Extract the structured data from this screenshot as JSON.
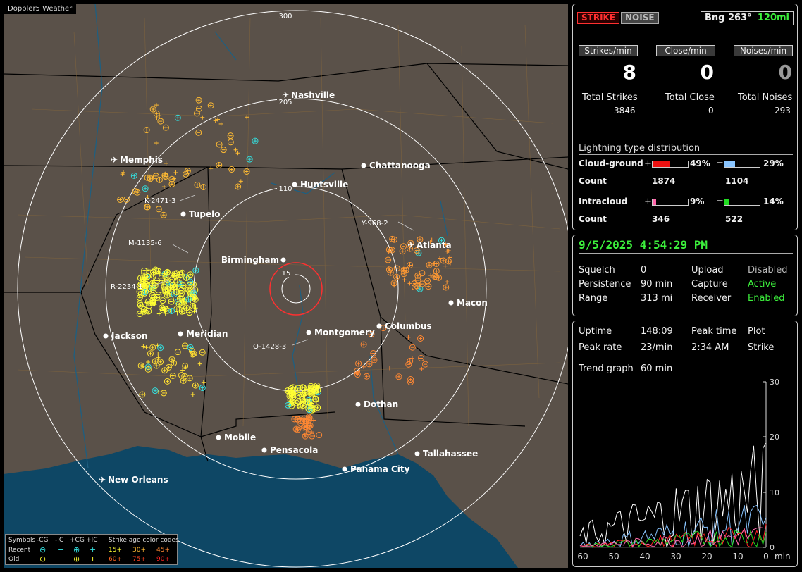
{
  "app": {
    "title": "Doppler5 Weather"
  },
  "map": {
    "ring_labels": [
      "300",
      "205",
      "110",
      "15"
    ],
    "cities": [
      {
        "name": "Nashville",
        "icon": "airport-icon"
      },
      {
        "name": "Memphis",
        "icon": "airport-icon"
      },
      {
        "name": "Chattanooga",
        "icon": "city-dot-icon"
      },
      {
        "name": "Huntsville",
        "icon": "city-dot-icon"
      },
      {
        "name": "Tupelo",
        "icon": "city-dot-icon"
      },
      {
        "name": "Atlanta",
        "icon": "airport-icon"
      },
      {
        "name": "Birmingham",
        "icon": "city-dot-icon"
      },
      {
        "name": "Macon",
        "icon": "city-dot-icon"
      },
      {
        "name": "Jackson",
        "icon": "city-dot-icon"
      },
      {
        "name": "Meridian",
        "icon": "city-dot-icon"
      },
      {
        "name": "Montgomery",
        "icon": "city-dot-icon"
      },
      {
        "name": "Columbus",
        "icon": "city-dot-icon"
      },
      {
        "name": "Dothan",
        "icon": "city-dot-icon"
      },
      {
        "name": "Mobile",
        "icon": "city-dot-icon"
      },
      {
        "name": "Pensacola",
        "icon": "city-dot-icon"
      },
      {
        "name": "Tallahassee",
        "icon": "city-dot-icon"
      },
      {
        "name": "Panama City",
        "icon": "city-dot-icon"
      },
      {
        "name": "New Orleans",
        "icon": "airport-icon"
      }
    ],
    "storms": [
      "K-2471-3",
      "M-1135-6",
      "R-2234-1",
      "Y-968-2",
      "Q-1428-3"
    ],
    "legend": {
      "symbols_label": "Symbols",
      "col_cg_minus": "-CG",
      "col_ic_minus": "-IC",
      "col_cg_plus": "+CG",
      "col_ic_plus": "+IC",
      "recent_label": "Recent",
      "old_label": "Old",
      "age_title": "Strike age color codes",
      "age_codes": [
        "15+",
        "30+",
        "45+",
        "60+",
        "75+",
        "90+"
      ],
      "age_colors": [
        "#ffff33",
        "#ffbb33",
        "#ff8833",
        "#ff6622",
        "#ff4422",
        "#ff2222"
      ]
    }
  },
  "status": {
    "strike_tab": "STRIKE",
    "noise_tab": "NOISE",
    "bearing": "Bng 263°",
    "range_label": "120mi",
    "strikes_per_min_label": "Strikes/min",
    "close_per_min_label": "Close/min",
    "noises_per_min_label": "Noises/min",
    "strikes_per_min": "8",
    "close_per_min": "0",
    "noises_per_min": "0",
    "total_strikes_label": "Total Strikes",
    "total_close_label": "Total Close",
    "total_noises_label": "Total Noises",
    "total_strikes": "3846",
    "total_close": "0",
    "total_noises": "293",
    "dist_title": "Lightning type distribution",
    "cg_label": "Cloud-ground",
    "ic_label": "Intracloud",
    "count_label": "Count",
    "plus": "+",
    "minus": "−",
    "cg_plus_pct": "49%",
    "cg_minus_pct": "29%",
    "ic_plus_pct": "9%",
    "ic_minus_pct": "14%",
    "cg_plus_count": "1874",
    "cg_minus_count": "1104",
    "ic_plus_count": "346",
    "ic_minus_count": "522",
    "cg_plus_fill": 0.49,
    "cg_minus_fill": 0.29,
    "ic_plus_fill": 0.09,
    "ic_minus_fill": 0.14
  },
  "settings": {
    "datetime": "9/5/2025 4:54:29 PM",
    "squelch_label": "Squelch",
    "squelch": "0",
    "persistence_label": "Persistence",
    "persistence": "90 min",
    "range_label": "Range",
    "range": "313 mi",
    "upload_label": "Upload",
    "upload": "Disabled",
    "capture_label": "Capture",
    "capture": "Active",
    "receiver_label": "Receiver",
    "receiver": "Enabled"
  },
  "stats": {
    "uptime_label": "Uptime",
    "uptime": "148:09",
    "peak_time_label": "Peak time",
    "peak_time": "2:34 AM",
    "plot_label": "Plot",
    "plot": "Strike",
    "peak_rate_label": "Peak rate",
    "peak_rate": "23/min",
    "trend_label": "Trend graph",
    "trend": "60 min",
    "y_ticks": [
      "30",
      "20",
      "10",
      "0"
    ],
    "x_ticks": [
      "60",
      "50",
      "40",
      "30",
      "20",
      "10",
      "0"
    ],
    "x_unit": "min"
  },
  "colors": {
    "accent_green": "#3cf03c",
    "strike_red": "#ff3030",
    "bar_red": "#ee1111",
    "bar_blue": "#88c4ff",
    "bar_pink": "#ff66aa",
    "bar_green": "#22dd22"
  }
}
